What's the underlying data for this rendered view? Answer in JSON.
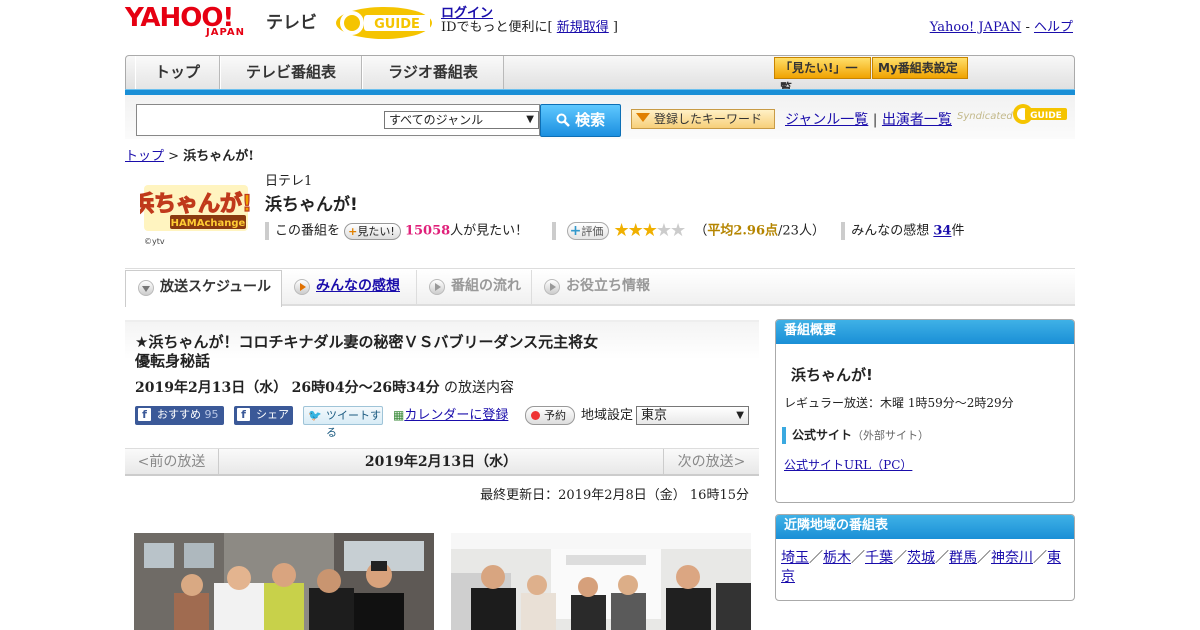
{
  "header": {
    "logo_yahoo": "YAHOO!",
    "logo_japan": "JAPAN",
    "logo_tv": "テレビ",
    "logo_gguide": "G-GUIDE",
    "login_label": "ログイン",
    "login_sub_prefix": "IDでもっと便利に[ ",
    "register_label": "新規取得",
    "login_sub_suffix": " ]",
    "yahoo_japan_link": "Yahoo! JAPAN",
    "separator": " - ",
    "help_link": "ヘルプ"
  },
  "nav": {
    "tabs": [
      "トップ",
      "テレビ番組表",
      "ラジオ番組表"
    ],
    "mitai_list_btn": "「見たい!」一覧",
    "my_schedule_btn": "My番組表設定"
  },
  "search": {
    "genre_value": "すべてのジャンル",
    "search_btn": "検索",
    "keyword_btn": "登録したキーワード",
    "genre_list_link": "ジャンル一覧",
    "divider": "|",
    "performer_list_link": "出演者一覧",
    "syndicated": "Syndicated",
    "synd_logo": "G-GUIDE"
  },
  "breadcrumb": {
    "top_link": "トップ",
    "sep": " > ",
    "current": "浜ちゃんが!"
  },
  "program": {
    "logo_text": "浜ちゃんが!",
    "logo_sub": "HAMAchange",
    "copyright": "©ytv",
    "channel": "日テレ1",
    "title": "浜ちゃんが!",
    "this_program": "この番組を",
    "mitai_btn": "見たい!",
    "mitai_count": "15058",
    "mitai_suffix": "人が見たい！",
    "rate_btn": "評価",
    "rating_prefix": "（",
    "rating_avg": "平均2.96点",
    "rating_suffix": "/23人）",
    "rating_value": 2.96,
    "impressions_label": "みんなの感想",
    "impressions_count": "34",
    "impressions_suffix": "件"
  },
  "tabs": [
    "放送スケジュール",
    "みんなの感想",
    "番組の流れ",
    "お役立ち情報"
  ],
  "episode": {
    "title": "★浜ちゃんが！コロチキナダル妻の秘密ＶＳバブリーダンス元主将女優転身秘話",
    "date": "2019年2月13日（水）",
    "time": "26時04分～26時34分",
    "date_suffix": "の放送内容",
    "fb_recommend": "おすすめ",
    "fb_count": "95",
    "fb_share": "シェア",
    "tweet": "ツイートする",
    "calendar": "カレンダーに登録",
    "reserve": "予約",
    "region_label": "地域設定",
    "region_value": "東京",
    "prev": "<前の放送",
    "current_date": "2019年2月13日（水）",
    "next": "次の放送>",
    "updated": "最終更新日：2019年2月8日（金）  16時15分"
  },
  "sidebar": {
    "overview_head": "番組概要",
    "overview_title": "浜ちゃんが!",
    "regular": "レギュラー放送：木曜 1時59分～2時29分",
    "official_label": "公式サイト",
    "official_note": "（外部サイト）",
    "official_url": "公式サイトURL（PC）",
    "nearby_head": "近隣地域の番組表",
    "nearby": [
      "埼玉",
      "栃木",
      "千葉",
      "茨城",
      "群馬",
      "神奈川",
      "東京"
    ],
    "nearby_sep": "／"
  },
  "colors": {
    "accent": "#1a8fd6",
    "link": "#1a0dab",
    "yahoo_red": "#e60012",
    "pink": "#e0207a",
    "star": "#f0b000"
  }
}
